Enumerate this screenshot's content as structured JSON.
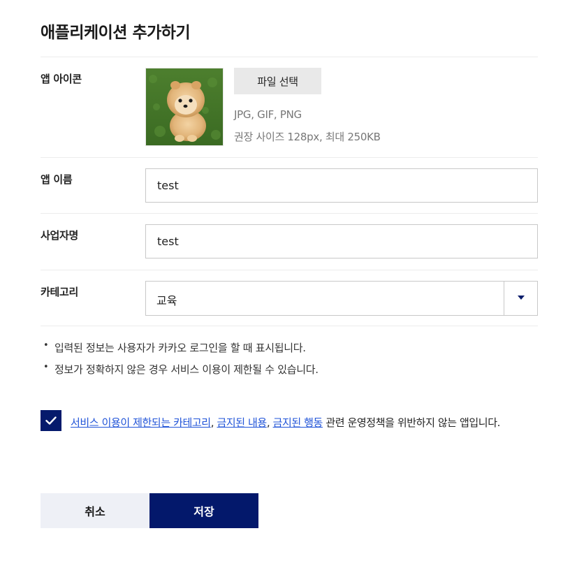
{
  "dialog": {
    "title": "애플리케이션 추가하기"
  },
  "icon_row": {
    "label": "앱 아이콘",
    "file_button": "파일 선택",
    "formats": "JPG, GIF, PNG",
    "size_hint": "권장 사이즈 128px, 최대 250KB",
    "preview": "pomeranian-dog-image"
  },
  "app_name": {
    "label": "앱 이름",
    "value": "test"
  },
  "company": {
    "label": "사업자명",
    "value": "test"
  },
  "category": {
    "label": "카테고리",
    "selected": "교육"
  },
  "notes": {
    "bullet": "•",
    "items": [
      "입력된 정보는 사용자가 카카오 로그인을 할 때 표시됩니다.",
      "정보가 정확하지 않은 경우 서비스 이용이 제한될 수 있습니다."
    ]
  },
  "agreement": {
    "checked": true,
    "link1": "서비스 이용이 제한되는 카테고리",
    "sep1": ", ",
    "link2": "금지된 내용",
    "sep2": ", ",
    "link3": "금지된 행동",
    "rest": " 관련 운영정책을 위반하지 않는 앱입니다."
  },
  "buttons": {
    "cancel": "취소",
    "save": "저장"
  },
  "colors": {
    "primary": "#03186b",
    "link": "#2154d8",
    "cancel_bg": "#eef0f6"
  }
}
